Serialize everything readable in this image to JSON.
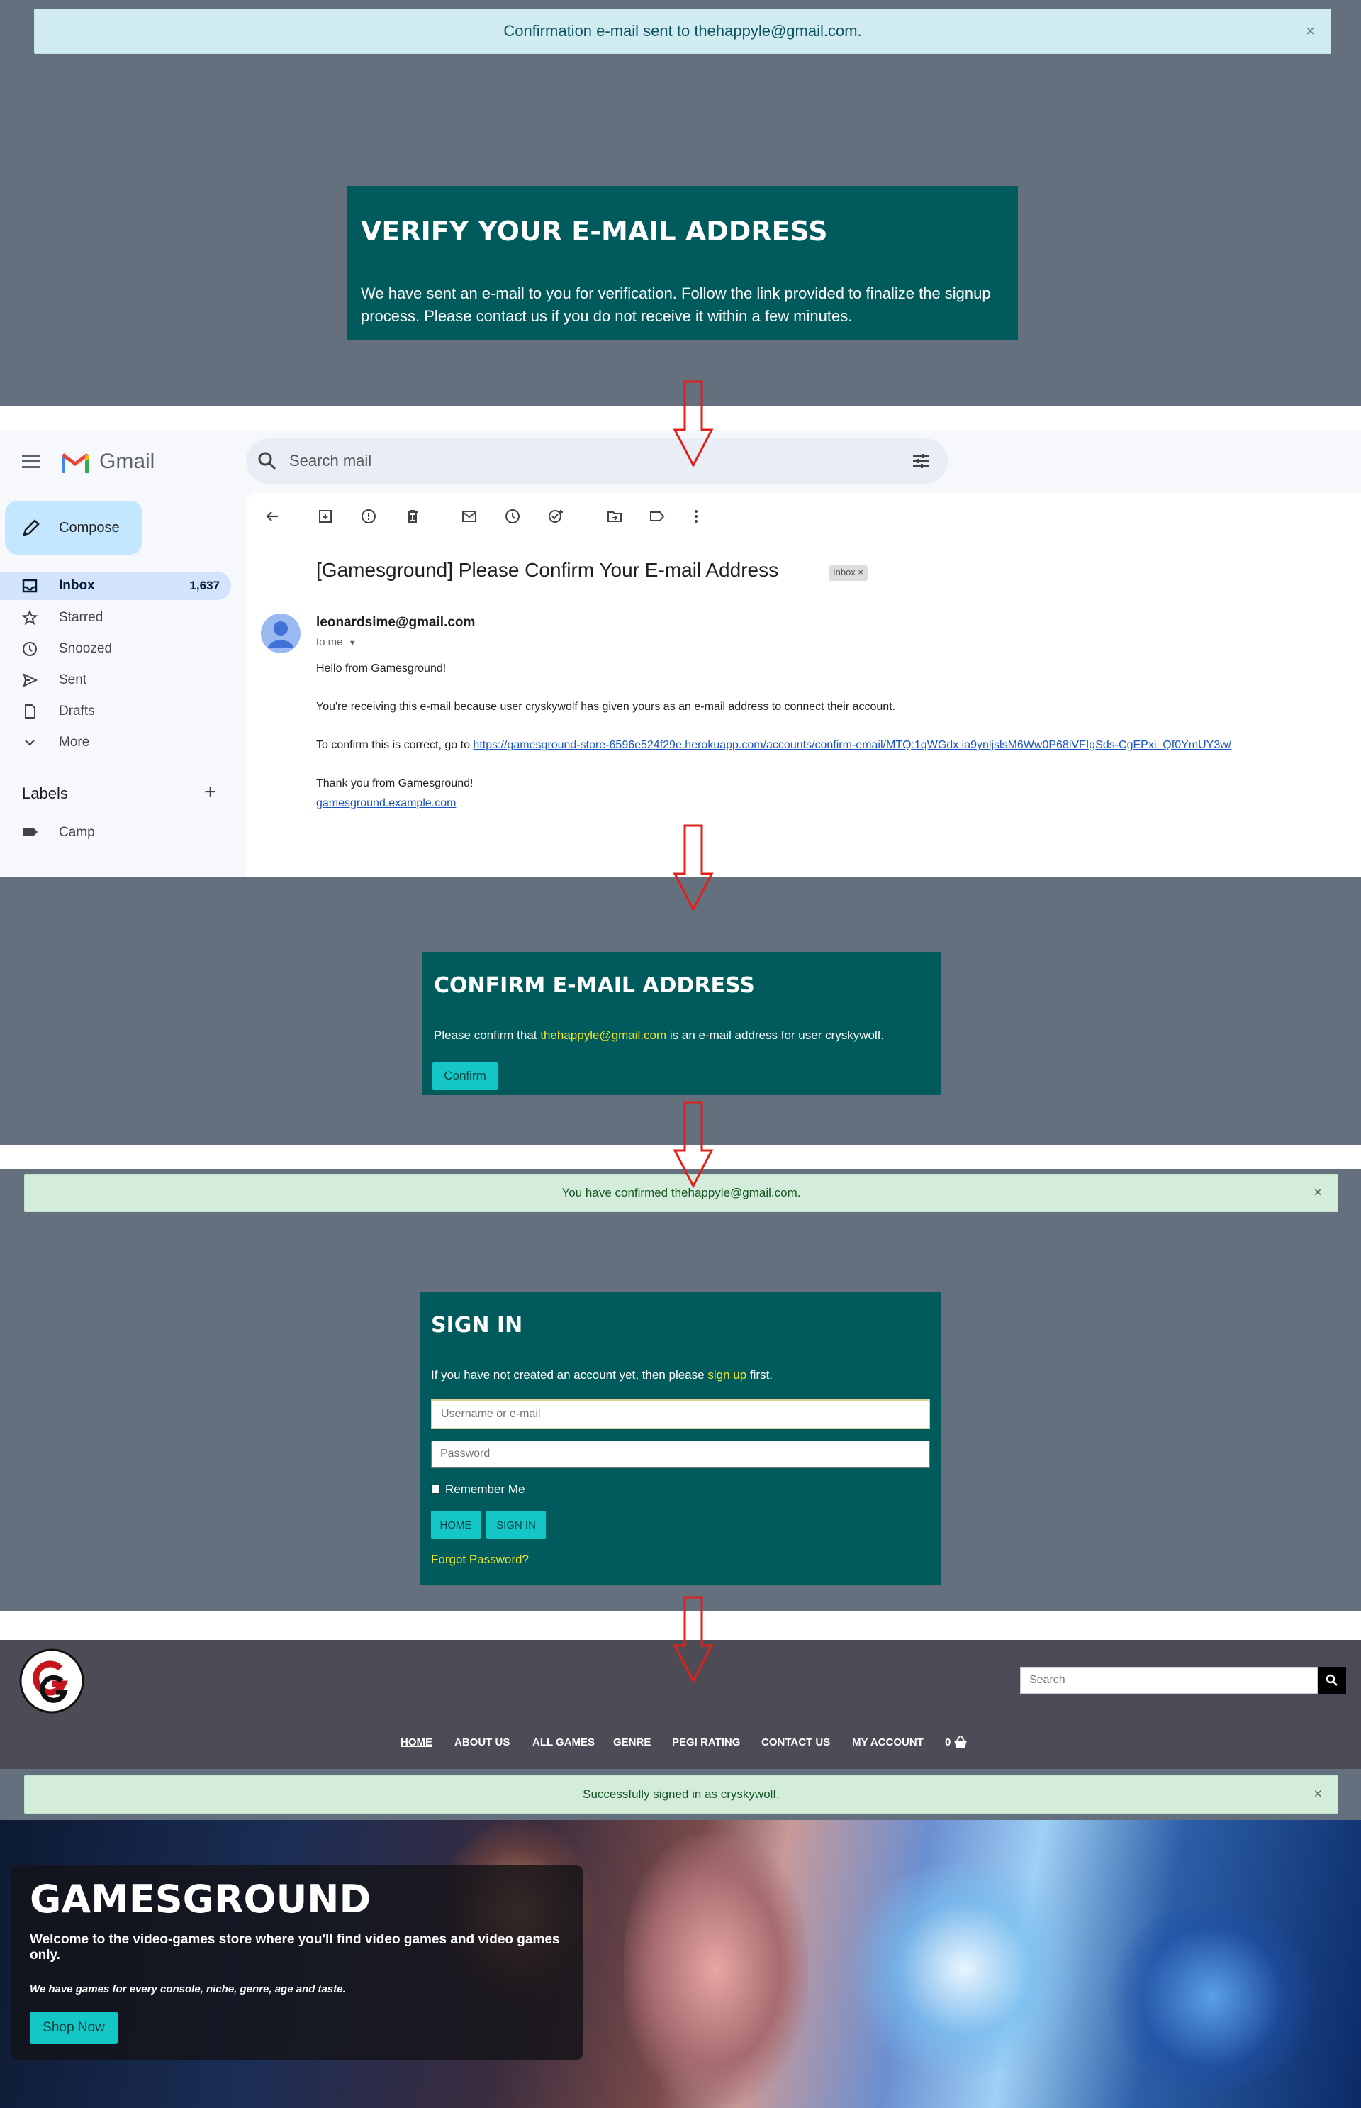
{
  "step1": {
    "alert_text": "Confirmation e-mail sent to thehappyle@gmail.com.",
    "close": "×",
    "card_title": "VERIFY YOUR E-MAIL ADDRESS",
    "card_body": "We have sent an e-mail to you for verification. Follow the link provided to finalize the signup process. Please contact us if you do not receive it within a few minutes."
  },
  "gmail": {
    "logo_text": "Gmail",
    "search_placeholder": "Search mail",
    "compose": "Compose",
    "nav": [
      {
        "label": "Inbox",
        "count": "1,637"
      },
      {
        "label": "Starred"
      },
      {
        "label": "Snoozed"
      },
      {
        "label": "Sent"
      },
      {
        "label": "Drafts"
      },
      {
        "label": "More"
      }
    ],
    "labels_heading": "Labels",
    "labels_add": "+",
    "label_items": [
      "Camp"
    ],
    "subject": "[Gamesground] Please Confirm Your E-mail Address",
    "subject_tag": "Inbox ×",
    "sender": "leonardsime@gmail.com",
    "to": "to me",
    "body_greeting": "Hello from Gamesground!",
    "body_line1": "You're receiving this e-mail because user cryskywolf has given yours as an e-mail address to connect their account.",
    "body_line2_prefix": "To confirm this is correct, go to",
    "body_link": "https://gamesground-store-6596e524f29e.herokuapp.com/accounts/confirm-email/MTQ:1qWGdx:ia9ynljslsM6Ww0P68lVFIgSds-CgEPxi_Qf0YmUY3w/",
    "body_thanks": "Thank you from Gamesground!",
    "body_site": "gamesground.example.com"
  },
  "step3": {
    "card_title": "CONFIRM E-MAIL ADDRESS",
    "text_prefix": "Please confirm that",
    "email": "thehappyle@gmail.com",
    "text_suffix": "is an e-mail address for user cryskywolf.",
    "confirm_button": "Confirm"
  },
  "step4": {
    "alert_text": "You have confirmed thehappyle@gmail.com.",
    "close": "×",
    "card_title": "SIGN IN",
    "text_prefix": "If you have not created an account yet, then please",
    "signup_link": "sign up",
    "text_suffix": "first.",
    "username_placeholder": "Username or e-mail",
    "password_placeholder": "Password",
    "remember": "Remember Me",
    "home_button": "HOME",
    "signin_button": "SIGN IN",
    "forgot": "Forgot Password?"
  },
  "step5": {
    "search_placeholder": "Search",
    "nav": [
      "HOME",
      "ABOUT US",
      "ALL GAMES",
      "GENRE",
      "PEGI RATING",
      "CONTACT US",
      "MY ACCOUNT"
    ],
    "cart_count": "0",
    "alert_text": "Successfully signed in as cryskywolf.",
    "close": "×",
    "hero_title": "GAMESGROUND",
    "hero_subtitle": "Welcome to the video-games store where you'll find video games and video games only.",
    "hero_note": "We have games for every console, niche, genre, age and taste.",
    "shop_button": "Shop Now"
  },
  "colors": {
    "grey_panel": "#65707e",
    "teal_card": "#015b5c",
    "cyan_button": "#14c6c6",
    "info_alert": "#d1ecf1",
    "success_alert": "#d4edda",
    "arrow_red": "#e0201a",
    "gmail_blue": "#c2e7ff",
    "link_yellow": "#f1e52a"
  }
}
